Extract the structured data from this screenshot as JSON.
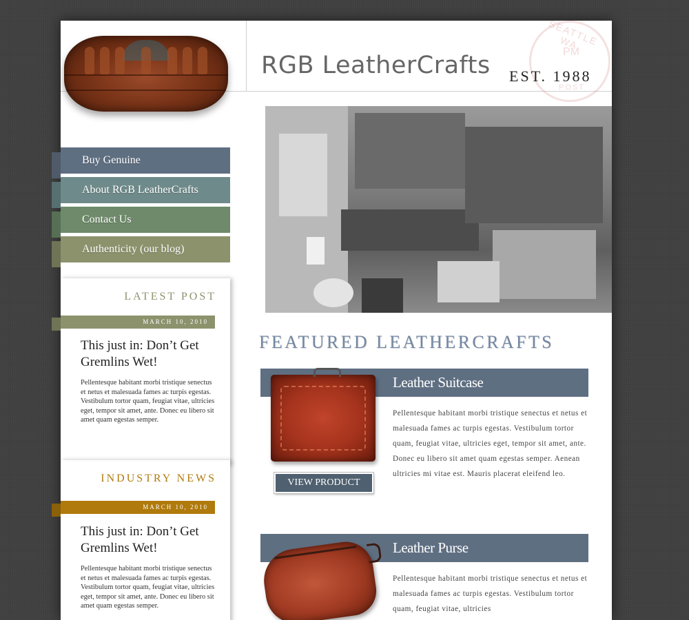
{
  "header": {
    "site_title": "RGB LeatherCrafts",
    "established": "EST. 1988"
  },
  "nav": {
    "items": [
      {
        "label": "Buy Genuine",
        "color": "#5f6f82"
      },
      {
        "label": "About RGB LeatherCrafts",
        "color": "#6f8a8a"
      },
      {
        "label": "Contact Us",
        "color": "#6e8a6a"
      },
      {
        "label": "Authenticity (our blog)",
        "color": "#8c926c"
      }
    ]
  },
  "latest_post": {
    "heading": "LATEST POST",
    "date": "MARCH 10, 2010",
    "title": "This just in: Don’t Get Gremlins Wet!",
    "body": "Pellentesque habitant morbi tristique senectus et netus et malesuada fames ac turpis egestas. Vestibulum tortor quam, feugiat vitae, ultricies eget, tempor sit amet, ante. Donec eu libero sit amet quam egestas semper.",
    "accent_color": "#8c926c"
  },
  "industry_news": {
    "heading": "INDUSTRY NEWS",
    "date": "MARCH 10, 2010",
    "title": "This just in: Don’t Get Gremlins Wet!",
    "body": "Pellentesque habitant morbi tristique senectus et netus et malesuada fames ac turpis egestas. Vestibulum tortor quam, feugiat vitae, ultricies eget, tempor sit amet, ante. Donec eu libero sit amet quam egestas semper.",
    "accent_color": "#b07a0c"
  },
  "featured": {
    "heading": "FEATURED LEATHERCRAFTS",
    "products": [
      {
        "name": "Leather Suitcase",
        "description": "Pellentesque habitant morbi tristique senectus et netus et malesuada fames ac turpis egestas. Vestibulum tortor quam, feugiat vitae, ultricies eget, tempor sit amet, ante. Donec eu libero sit amet quam egestas semper. Aenean ultricies mi vitae est. Mauris placerat eleifend leo.",
        "button_label": "VIEW PRODUCT"
      },
      {
        "name": "Leather Purse",
        "description": "Pellentesque habitant morbi tristique senectus et netus et malesuada fames ac turpis egestas. Vestibulum tortor quam, feugiat vitae, ultricies"
      }
    ]
  },
  "stamp": {
    "text": "SEATTLE WA",
    "time": "PM"
  }
}
